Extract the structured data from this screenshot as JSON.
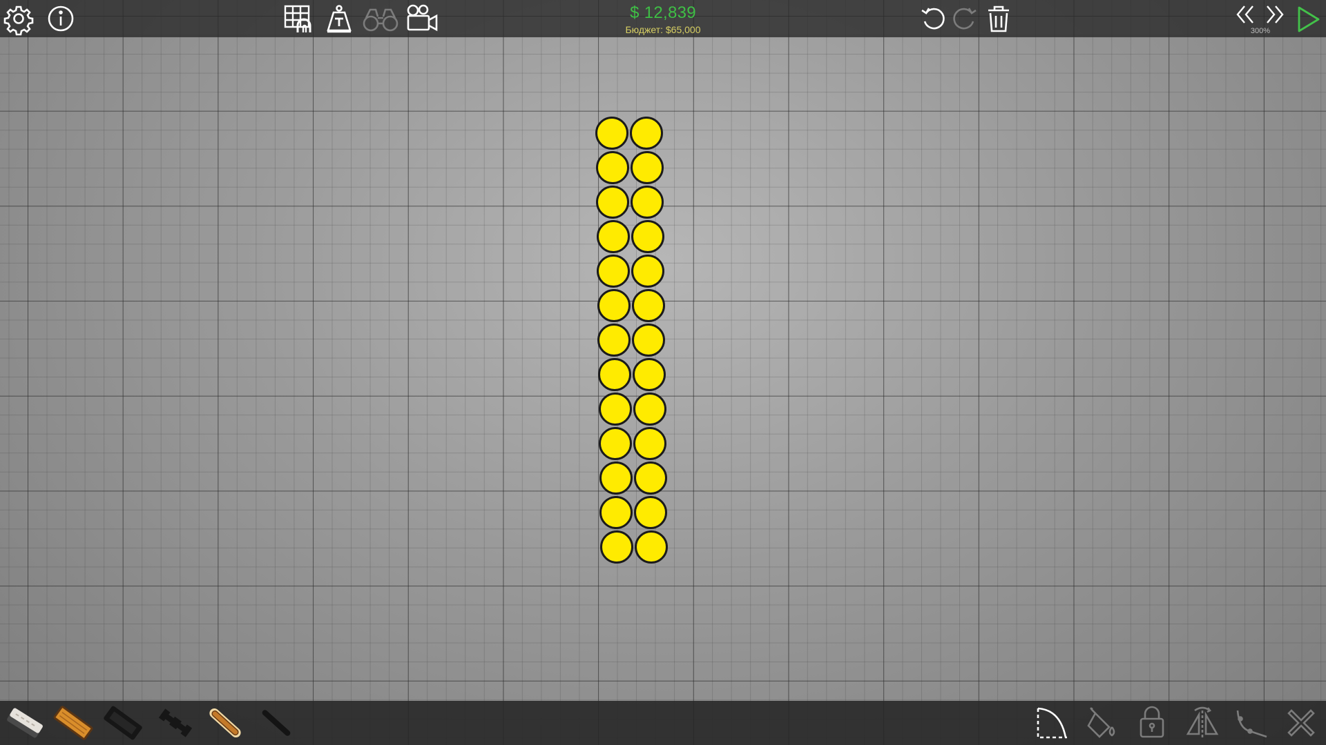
{
  "top_bar": {
    "money": "$ 12,839",
    "budget": "Бюджет: $65,000",
    "speed": "300%",
    "icons": [
      "gear-icon",
      "info-icon",
      "bridge-layout-icon",
      "weight-icon",
      "binoculars-icon",
      "camera-icon",
      "undo-icon",
      "redo-icon",
      "trash-icon",
      "slow-down-icon",
      "speed-up-icon",
      "play-icon"
    ]
  },
  "bottom_bar": {
    "materials": [
      "road-material",
      "wood-material",
      "reinforced-road-material",
      "steel-material",
      "rope-material",
      "cable-material"
    ],
    "tools": [
      "arc-tool-icon",
      "paint-bucket-icon",
      "lock-icon",
      "mirror-icon",
      "split-joint-icon",
      "close-icon"
    ],
    "selected_material": "rope-material"
  },
  "scene": {
    "object": "ball-stack",
    "columns": 2,
    "rows": 13,
    "ball_color": "#ffeb00",
    "outline_color": "#1b1b1b"
  },
  "colors": {
    "money": "#3fbf46",
    "budget": "#d7cf63",
    "play": "#43c24a",
    "icon": "#ffffff",
    "icon_disabled": "#7c7c7c"
  }
}
